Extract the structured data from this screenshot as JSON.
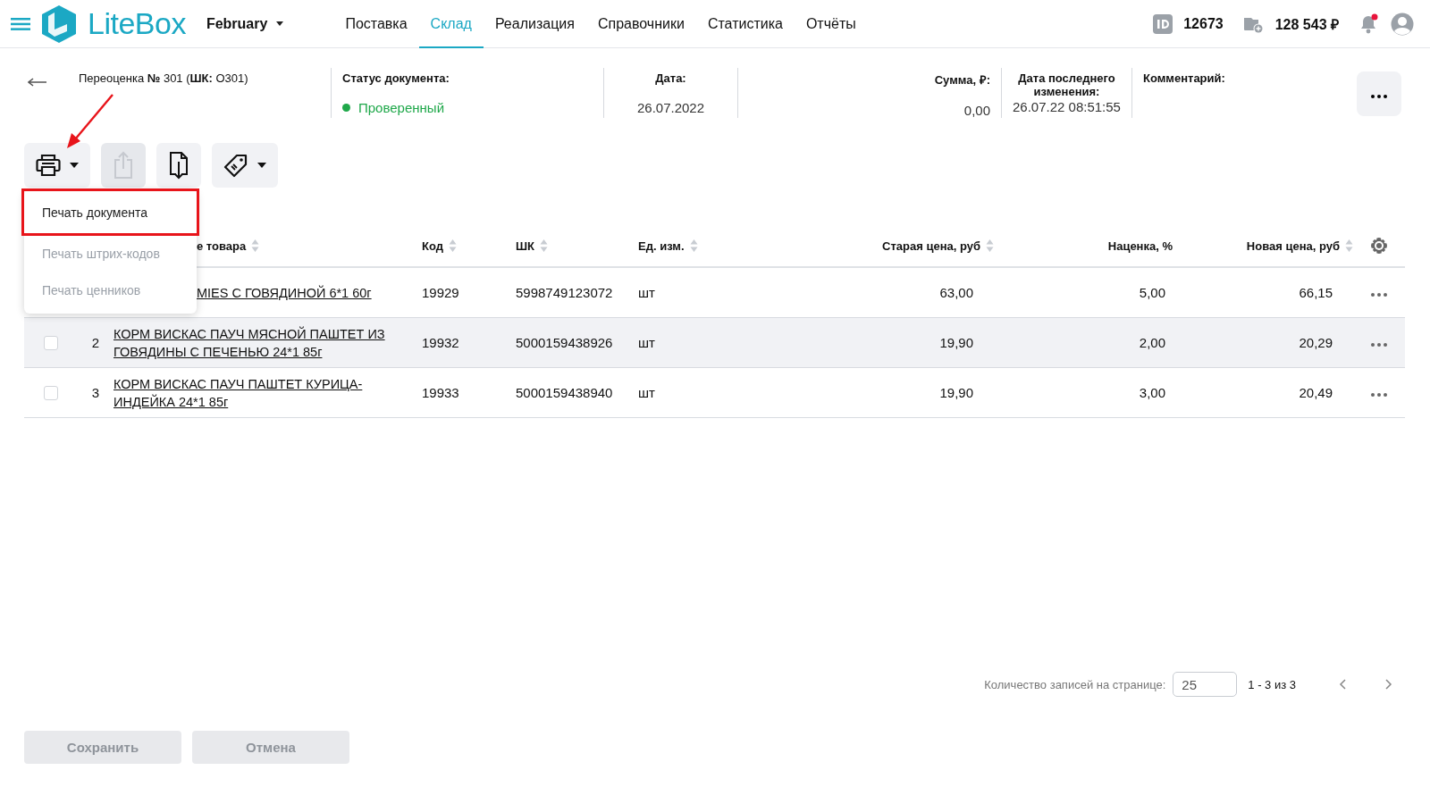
{
  "app": {
    "logo": "LiteBox",
    "period": "February"
  },
  "nav": [
    {
      "label": "Поставка",
      "selected": false
    },
    {
      "label": "Склад",
      "selected": true
    },
    {
      "label": "Реализация",
      "selected": false
    },
    {
      "label": "Справочники",
      "selected": false
    },
    {
      "label": "Статистика",
      "selected": false
    },
    {
      "label": "Отчёты",
      "selected": false
    }
  ],
  "account": {
    "id": "12673",
    "balance": "128 543 ₽",
    "has_notifications": true
  },
  "document": {
    "title": "Переоценка **№** 301 (**ШК:** О301)",
    "fields": [
      {
        "label": "Статус документа:",
        "value": "Проверенный",
        "kind": "status",
        "color": "#1fa84a"
      },
      {
        "label": "Дата:",
        "value": "26.07.2022",
        "kind": "center"
      },
      {
        "label": "Сумма, ₽:",
        "value": "0,00",
        "kind": "right"
      },
      {
        "label": "Дата последнего изменения:",
        "value": "26.07.22 08:51:55",
        "kind": "center"
      },
      {
        "label": "Комментарий:",
        "kind": "left"
      }
    ]
  },
  "toolbar": [
    {
      "kind": "print",
      "dropdown": true,
      "disabled": false
    },
    {
      "kind": "export",
      "dropdown": false,
      "disabled": true
    },
    {
      "kind": "import",
      "dropdown": false,
      "disabled": false
    },
    {
      "kind": "tag",
      "dropdown": true,
      "disabled": false
    }
  ],
  "print_menu": [
    {
      "label": "Печать документа",
      "disabled": false,
      "highlighted": true
    },
    {
      "label": "Печать штрих-кодов",
      "disabled": true,
      "highlighted": false
    },
    {
      "label": "Печать ценников",
      "disabled": true,
      "highlighted": false
    }
  ],
  "table": {
    "columns": [
      {
        "label": "е товара",
        "sortable": true
      },
      {
        "label": "Код",
        "sortable": true
      },
      {
        "label": "ШК",
        "sortable": true
      },
      {
        "label": "Ед. изм.",
        "sortable": true
      },
      {
        "label": "Старая цена, руб",
        "sortable": true
      },
      {
        "label": "Наценка, %",
        "sortable": false
      },
      {
        "label": "Новая цена, руб",
        "sortable": true
      }
    ],
    "rows": [
      {
        "name": "MIES С ГОВЯДИНОЙ 6*1 60г",
        "code": "19929",
        "barcode": "5998749123072",
        "unit": "шт",
        "old_price": "63,00",
        "markup": "5,00",
        "new_price": "66,15",
        "selected": false
      },
      {
        "number": "2",
        "checked": false,
        "name": "КОРМ ВИСКАС ПАУЧ МЯСНОЙ ПАШТЕТ ИЗ ГОВЯДИНЫ С ПЕЧЕНЬЮ 24*1 85г",
        "code": "19932",
        "barcode": "5000159438926",
        "unit": "шт",
        "old_price": "19,90",
        "markup": "2,00",
        "new_price": "20,29",
        "selected": true
      },
      {
        "number": "3",
        "checked": false,
        "name": "КОРМ ВИСКАС ПАУЧ ПАШТЕТ КУРИЦА-ИНДЕЙКА 24*1 85г",
        "code": "19933",
        "barcode": "5000159438940",
        "unit": "шт",
        "old_price": "19,90",
        "markup": "3,00",
        "new_price": "20,49",
        "selected": false
      }
    ]
  },
  "pagination": {
    "label": "Количество записей на странице:",
    "page_size": "25",
    "range": "1 - 3 из 3"
  },
  "buttons": [
    {
      "label": "Сохранить",
      "disabled": true
    },
    {
      "label": "Отмена",
      "disabled": true
    }
  ]
}
